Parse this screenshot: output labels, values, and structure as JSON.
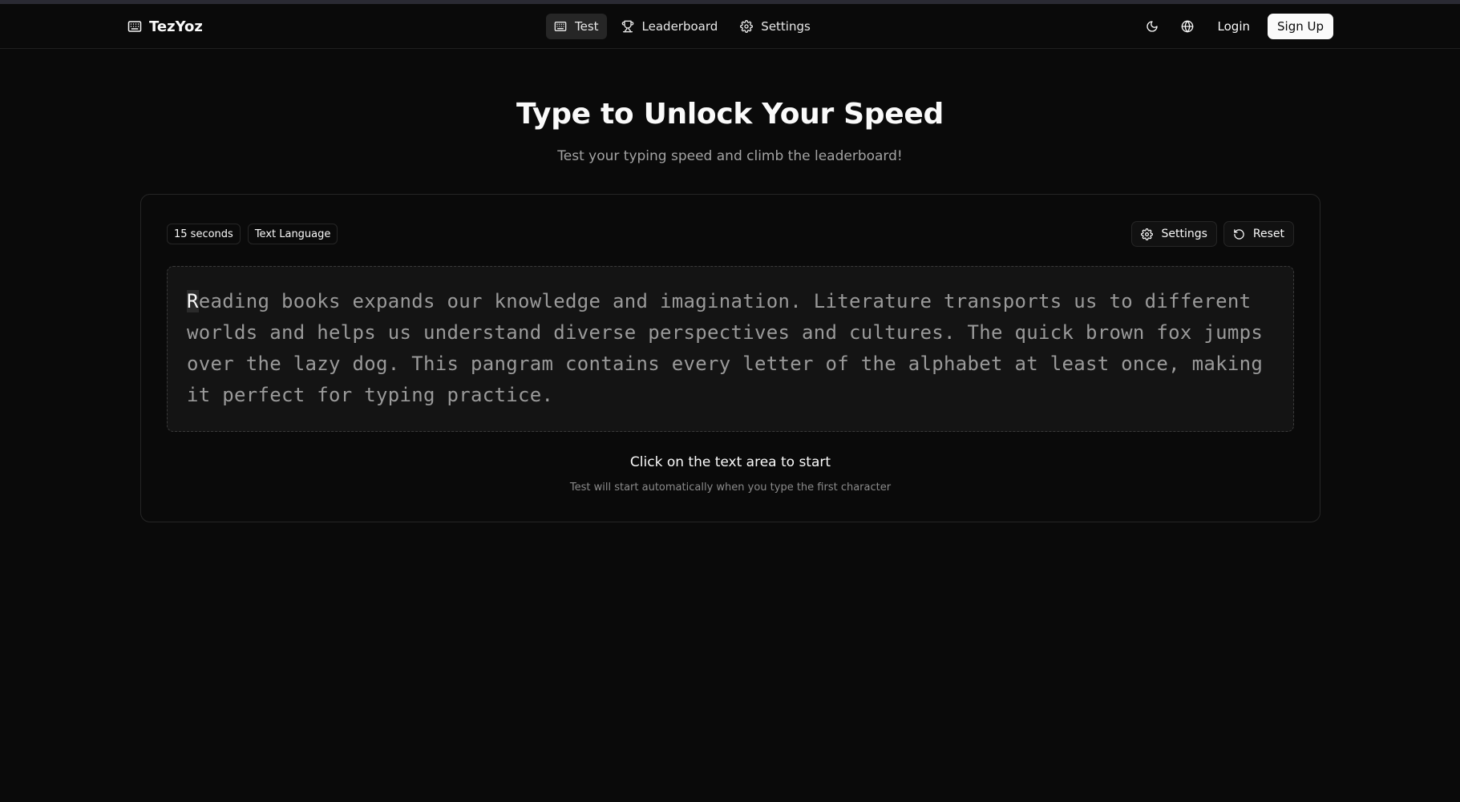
{
  "brand": {
    "name": "TezYoz",
    "icon": "keyboard-icon"
  },
  "nav": {
    "items": [
      {
        "label": "Test",
        "icon": "keyboard-icon",
        "active": true
      },
      {
        "label": "Leaderboard",
        "icon": "trophy-icon",
        "active": false
      },
      {
        "label": "Settings",
        "icon": "gear-icon",
        "active": false
      }
    ]
  },
  "header_actions": {
    "theme_icon": "moon-icon",
    "language_icon": "globe-icon",
    "login_label": "Login",
    "signup_label": "Sign Up"
  },
  "hero": {
    "title": "Type to Unlock Your Speed",
    "subtitle": "Test your typing speed and climb the leaderboard!"
  },
  "test_card": {
    "badges": [
      "15 seconds",
      "Text Language"
    ],
    "settings_label": "Settings",
    "reset_label": "Reset",
    "text_first_char": "R",
    "text_rest": "eading books expands our knowledge and imagination. Literature transports us to different worlds and helps us understand diverse perspectives and cultures. The quick brown fox jumps over the lazy dog. This pangram contains every letter of the alphabet at least once, making it perfect for typing practice.",
    "hint_main": "Click on the text area to start",
    "hint_sub": "Test will start automatically when you type the first character"
  },
  "colors": {
    "background": "#0a0a0a",
    "border": "#262626",
    "text_muted": "#9a9a9a",
    "accent_button": "#fafafa"
  }
}
